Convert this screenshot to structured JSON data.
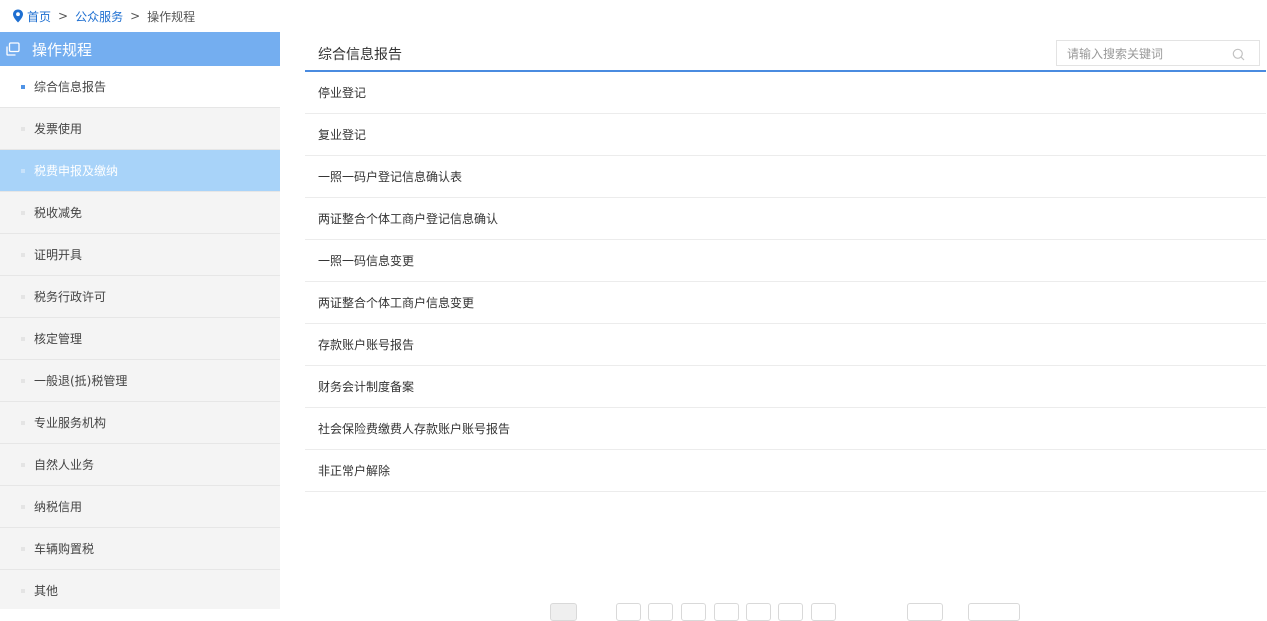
{
  "breadcrumb": {
    "home": "首页",
    "section": "公众服务",
    "current": "操作规程",
    "separator": ">"
  },
  "sidebar": {
    "title": "操作规程",
    "items": [
      {
        "label": "综合信息报告",
        "state": "current"
      },
      {
        "label": "发票使用",
        "state": ""
      },
      {
        "label": "税费申报及缴纳",
        "state": "active"
      },
      {
        "label": "税收减免",
        "state": ""
      },
      {
        "label": "证明开具",
        "state": ""
      },
      {
        "label": "税务行政许可",
        "state": ""
      },
      {
        "label": "核定管理",
        "state": ""
      },
      {
        "label": "一般退(抵)税管理",
        "state": ""
      },
      {
        "label": "专业服务机构",
        "state": ""
      },
      {
        "label": "自然人业务",
        "state": ""
      },
      {
        "label": "纳税信用",
        "state": ""
      },
      {
        "label": "车辆购置税",
        "state": ""
      },
      {
        "label": "其他",
        "state": ""
      }
    ]
  },
  "main": {
    "title": "综合信息报告",
    "search_placeholder": "请输入搜索关键词",
    "items": [
      "停业登记",
      "复业登记",
      "一照一码户登记信息确认表",
      "两证整合个体工商户登记信息确认",
      "一照一码信息变更",
      "两证整合个体工商户信息变更",
      "存款账户账号报告",
      "财务会计制度备案",
      "社会保险费缴费人存款账户账号报告",
      "非正常户解除"
    ]
  },
  "colors": {
    "sidebar_header": "#74aef0",
    "sidebar_active": "#a8d3f9",
    "link": "#1e6fd1",
    "header_underline": "#4a8be0",
    "current_marker": "#4f93e6"
  },
  "icons": {
    "breadcrumb": "location-pin-icon",
    "sidebar_header": "copy-icon",
    "search": "search-icon"
  }
}
